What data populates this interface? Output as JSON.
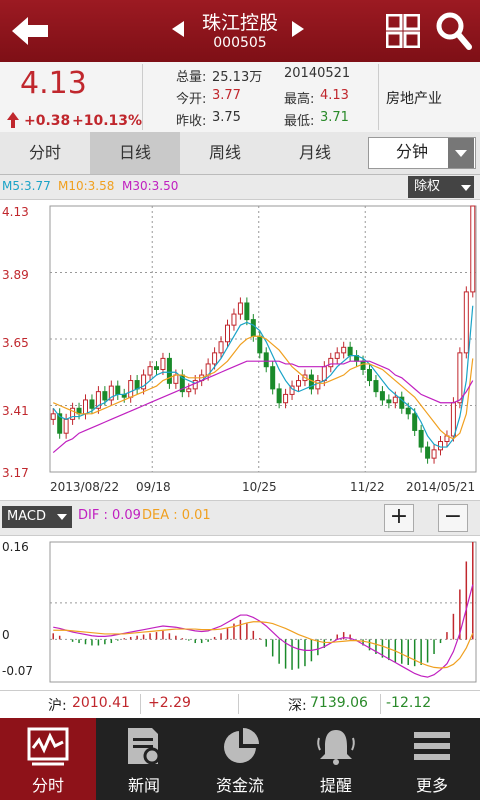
{
  "header": {
    "stock_name": "珠江控股",
    "stock_code": "000505"
  },
  "quote": {
    "price": "4.13",
    "change": "+0.38",
    "change_pct": "+10.13%",
    "volume_label": "总量:",
    "volume": "25.13万",
    "date": "20140521",
    "open_label": "今开:",
    "open": "3.77",
    "high_label": "最高:",
    "high": "4.13",
    "prev_close_label": "昨收:",
    "prev_close": "3.75",
    "low_label": "最低:",
    "low": "3.71",
    "industry": "房地产业"
  },
  "tabs": [
    {
      "label": "分时",
      "active": false
    },
    {
      "label": "日线",
      "active": true
    },
    {
      "label": "周线",
      "active": false
    },
    {
      "label": "月线",
      "active": false
    }
  ],
  "minute_select": "分钟",
  "ma": {
    "m5": "M5:3.77",
    "m10": "M10:3.58",
    "m30": "M30:3.50",
    "colors": {
      "m5": "#1aa3c7",
      "m10": "#f0a020",
      "m30": "#c020c0"
    }
  },
  "adjust_button": "除权",
  "chart_data": [
    {
      "type": "candlestick",
      "y_ticks": [
        "4.13",
        "3.89",
        "3.65",
        "3.41",
        "3.17"
      ],
      "x_ticks": [
        "2013/08/22",
        "09/18",
        "10/25",
        "11/22",
        "2014/05/21"
      ],
      "ylim": [
        3.17,
        4.13
      ],
      "up_color": "#c0272d",
      "down_color": "#1a8a2a",
      "close": [
        3.38,
        3.31,
        3.36,
        3.4,
        3.38,
        3.43,
        3.4,
        3.46,
        3.43,
        3.48,
        3.45,
        3.44,
        3.5,
        3.47,
        3.52,
        3.55,
        3.54,
        3.58,
        3.49,
        3.52,
        3.46,
        3.47,
        3.5,
        3.52,
        3.56,
        3.6,
        3.64,
        3.7,
        3.74,
        3.78,
        3.72,
        3.66,
        3.6,
        3.55,
        3.47,
        3.42,
        3.45,
        3.48,
        3.5,
        3.52,
        3.47,
        3.5,
        3.55,
        3.58,
        3.6,
        3.62,
        3.59,
        3.57,
        3.54,
        3.5,
        3.46,
        3.43,
        3.42,
        3.44,
        3.4,
        3.38,
        3.32,
        3.26,
        3.22,
        3.25,
        3.28,
        3.3,
        3.42,
        3.6,
        3.82,
        4.13
      ],
      "ma5": [
        3.4,
        3.37,
        3.36,
        3.37,
        3.37,
        3.38,
        3.39,
        3.41,
        3.42,
        3.44,
        3.45,
        3.45,
        3.46,
        3.47,
        3.48,
        3.5,
        3.52,
        3.53,
        3.53,
        3.53,
        3.51,
        3.5,
        3.49,
        3.5,
        3.52,
        3.55,
        3.58,
        3.62,
        3.66,
        3.7,
        3.71,
        3.7,
        3.68,
        3.64,
        3.59,
        3.54,
        3.5,
        3.47,
        3.46,
        3.47,
        3.48,
        3.49,
        3.5,
        3.52,
        3.55,
        3.57,
        3.59,
        3.59,
        3.58,
        3.56,
        3.53,
        3.5,
        3.47,
        3.45,
        3.43,
        3.41,
        3.39,
        3.35,
        3.3,
        3.27,
        3.26,
        3.26,
        3.29,
        3.37,
        3.5,
        3.77
      ],
      "ma10": [
        3.42,
        3.41,
        3.4,
        3.39,
        3.38,
        3.38,
        3.38,
        3.39,
        3.4,
        3.41,
        3.42,
        3.43,
        3.44,
        3.45,
        3.46,
        3.47,
        3.48,
        3.5,
        3.51,
        3.52,
        3.52,
        3.51,
        3.51,
        3.51,
        3.52,
        3.53,
        3.55,
        3.57,
        3.6,
        3.63,
        3.65,
        3.66,
        3.66,
        3.65,
        3.63,
        3.61,
        3.58,
        3.55,
        3.53,
        3.51,
        3.5,
        3.49,
        3.49,
        3.5,
        3.51,
        3.52,
        3.54,
        3.55,
        3.56,
        3.56,
        3.55,
        3.54,
        3.52,
        3.5,
        3.48,
        3.46,
        3.44,
        3.41,
        3.38,
        3.35,
        3.32,
        3.3,
        3.29,
        3.31,
        3.38,
        3.58
      ],
      "ma30": [
        3.24,
        3.26,
        3.28,
        3.29,
        3.31,
        3.32,
        3.33,
        3.34,
        3.35,
        3.36,
        3.37,
        3.38,
        3.39,
        3.4,
        3.41,
        3.42,
        3.43,
        3.44,
        3.45,
        3.46,
        3.47,
        3.48,
        3.49,
        3.5,
        3.51,
        3.52,
        3.53,
        3.54,
        3.55,
        3.56,
        3.57,
        3.57,
        3.57,
        3.57,
        3.57,
        3.57,
        3.56,
        3.56,
        3.55,
        3.55,
        3.55,
        3.55,
        3.55,
        3.56,
        3.56,
        3.56,
        3.57,
        3.57,
        3.57,
        3.57,
        3.56,
        3.55,
        3.54,
        3.52,
        3.51,
        3.49,
        3.47,
        3.45,
        3.44,
        3.43,
        3.42,
        3.42,
        3.42,
        3.43,
        3.46,
        3.5
      ]
    },
    {
      "type": "macd",
      "y_ticks": [
        "0.16",
        "0",
        "-0.07"
      ],
      "ylim": [
        -0.07,
        0.16
      ],
      "dif": [
        0.02,
        0.018,
        0.015,
        0.012,
        0.01,
        0.008,
        0.006,
        0.005,
        0.005,
        0.006,
        0.008,
        0.01,
        0.012,
        0.014,
        0.016,
        0.018,
        0.02,
        0.022,
        0.021,
        0.02,
        0.018,
        0.016,
        0.014,
        0.013,
        0.014,
        0.018,
        0.022,
        0.028,
        0.034,
        0.04,
        0.04,
        0.036,
        0.03,
        0.022,
        0.012,
        0.002,
        -0.006,
        -0.012,
        -0.016,
        -0.018,
        -0.018,
        -0.016,
        -0.012,
        -0.006,
        0.0,
        0.003,
        0.002,
        -0.002,
        -0.008,
        -0.014,
        -0.02,
        -0.026,
        -0.032,
        -0.038,
        -0.044,
        -0.05,
        -0.056,
        -0.06,
        -0.062,
        -0.058,
        -0.05,
        -0.04,
        -0.02,
        0.01,
        0.05,
        0.09
      ],
      "dea": [
        0.015,
        0.015,
        0.015,
        0.014,
        0.013,
        0.012,
        0.011,
        0.01,
        0.009,
        0.009,
        0.009,
        0.009,
        0.01,
        0.011,
        0.012,
        0.013,
        0.014,
        0.015,
        0.016,
        0.017,
        0.017,
        0.017,
        0.017,
        0.016,
        0.016,
        0.016,
        0.017,
        0.019,
        0.021,
        0.024,
        0.027,
        0.029,
        0.029,
        0.028,
        0.026,
        0.022,
        0.018,
        0.013,
        0.008,
        0.004,
        0.0,
        -0.003,
        -0.005,
        -0.005,
        -0.004,
        -0.003,
        -0.002,
        -0.002,
        -0.003,
        -0.005,
        -0.008,
        -0.011,
        -0.015,
        -0.019,
        -0.024,
        -0.029,
        -0.034,
        -0.039,
        -0.043,
        -0.046,
        -0.047,
        -0.046,
        -0.041,
        -0.031,
        -0.014,
        0.01
      ]
    }
  ],
  "macd_bar": {
    "selector": "MACD",
    "dif": "DIF : 0.09",
    "dea": "DEA : 0.01",
    "plus": "+",
    "minus": "−"
  },
  "index_bar": {
    "sh_label": "沪:",
    "sh_value": "2010.41",
    "sh_change": "+2.29",
    "sz_label": "深:",
    "sz_value": "7139.06",
    "sz_change": "-12.12"
  },
  "nav": [
    {
      "label": "分时",
      "icon": "chart-icon",
      "active": true
    },
    {
      "label": "新闻",
      "icon": "news-icon",
      "active": false
    },
    {
      "label": "资金流",
      "icon": "pie-icon",
      "active": false
    },
    {
      "label": "提醒",
      "icon": "bell-icon",
      "active": false
    },
    {
      "label": "更多",
      "icon": "menu-icon",
      "active": false
    }
  ]
}
